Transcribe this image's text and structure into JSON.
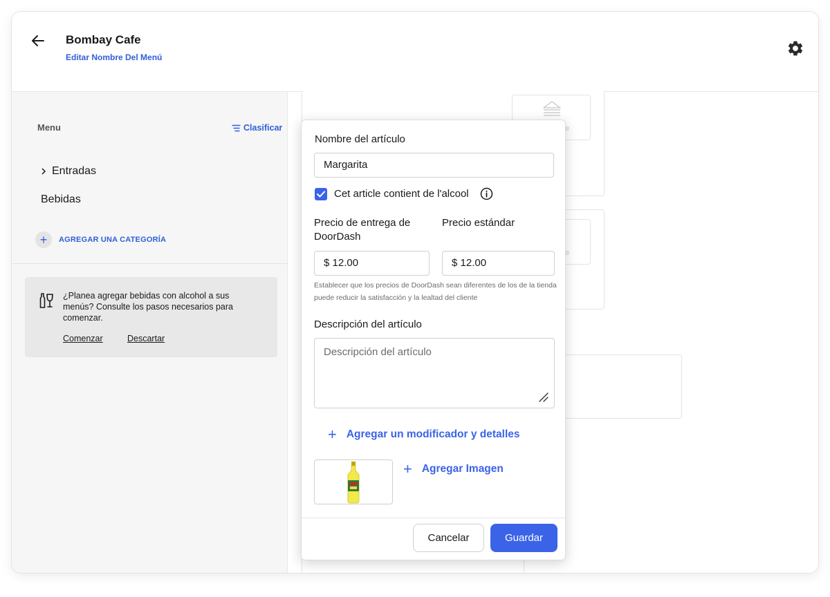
{
  "header": {
    "title": "Bombay Cafe",
    "edit_link": "Editar Nombre Del Menú"
  },
  "sidebar": {
    "menu_label": "Menu",
    "sort_label": "Clasificar",
    "categories": [
      {
        "label": "Entradas",
        "expandable": true
      },
      {
        "label": "Bebidas",
        "expandable": false
      }
    ],
    "add_category": "AGREGAR UNA CATEGORÍA",
    "notice": {
      "text": "¿Planea agregar bebidas con alcohol a sus menús? Consulte  los pasos necesarios para comenzar.",
      "start": "Comenzar",
      "dismiss": "Descartar"
    }
  },
  "background": {
    "partial_text_1": "e",
    "partial_text_2": "e"
  },
  "modal": {
    "name_label": "Nombre del artículo",
    "name_value": "Margarita",
    "alcohol_checkbox": {
      "label": "Cet article contient de l'alcool",
      "checked": true
    },
    "doordash_price_label": "Precio de entrega de DoorDash",
    "doordash_price_value": "$ 12.00",
    "standard_price_label": "Precio estándar",
    "standard_price_value": "$ 12.00",
    "price_hint": "Establecer que los precios de DoorDash sean diferentes de los de la tienda puede reducir la satisfacción y la lealtad del cliente",
    "description_label": "Descripción del artículo",
    "description_placeholder": "Descripción del artículo",
    "add_modifier": "Agregar un modificador y detalles",
    "add_image": "Agregar Imagen",
    "cancel": "Cancelar",
    "save": "Guardar"
  },
  "colors": {
    "accent": "#3a63e8",
    "link": "#2f5ed9",
    "sidebar_bg": "#f6f6f6",
    "notice_bg": "#e8e8e8"
  },
  "icons": [
    "arrow-left-icon",
    "gear-icon",
    "sort-lines-icon",
    "chevron-right-icon",
    "plus-icon",
    "bottles-icon",
    "check-icon",
    "info-icon",
    "resize-handle-icon",
    "sandwich-icon",
    "bottle-image"
  ]
}
